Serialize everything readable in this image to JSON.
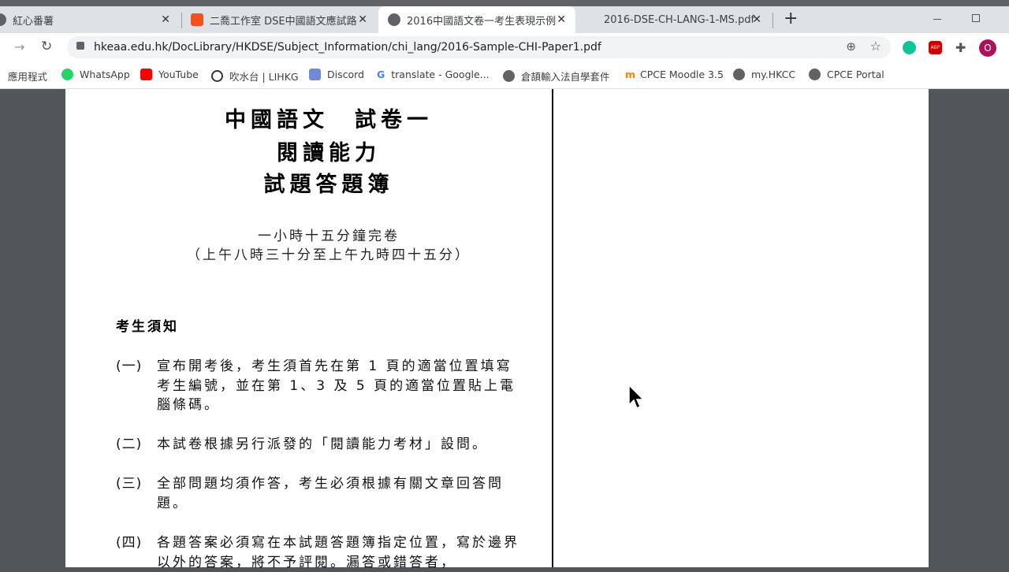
{
  "tabs": [
    {
      "title": "紅心番薯",
      "active": false
    },
    {
      "title": "二喬工作室 DSE中國語文應試路",
      "active": false
    },
    {
      "title": "2016中國語文卷一考生表現示例",
      "active": true
    },
    {
      "title": "2016-DSE-CH-LANG-1-MS.pdf",
      "active": false
    }
  ],
  "new_tab": "+",
  "close": "✕",
  "address": "hkeaa.edu.hk/DocLibrary/HKDSE/Subject_Information/chi_lang/2016-Sample-CHI-Paper1.pdf",
  "bookmarks": [
    "應用程式",
    "WhatsApp",
    "YouTube",
    "吹水台 | LIHKG",
    "Discord",
    "translate - Google...",
    "倉頡輸入法自學套件",
    "CPCE Moodle 3.5",
    "my.HKCC",
    "CPCE Portal"
  ],
  "profile_initial": "O",
  "doc": {
    "title_lines": [
      "中國語文　試卷一",
      "閱讀能力",
      "試題答題簿"
    ],
    "duration": "一小時十五分鐘完卷",
    "time": "（上午八時三十分至上午九時四十五分）",
    "notice_heading": "考生須知",
    "items": [
      {
        "num": "(一)",
        "text": "宣布開考後，考生須首先在第 1 頁的適當位置填寫考生編號，並在第 1、3 及 5 頁的適當位置貼上電腦條碼。"
      },
      {
        "num": "(二)",
        "text": "本試卷根據另行派發的「閱讀能力考材」設問。"
      },
      {
        "num": "(三)",
        "text": "全部問題均須作答，考生必須根據有關文章回答問題。"
      },
      {
        "num": "(四)",
        "text": "各題答案必須寫在本試題答題簿指定位置，寫於邊界以外的答案，將不予評閱。漏答或錯答者，"
      }
    ]
  }
}
